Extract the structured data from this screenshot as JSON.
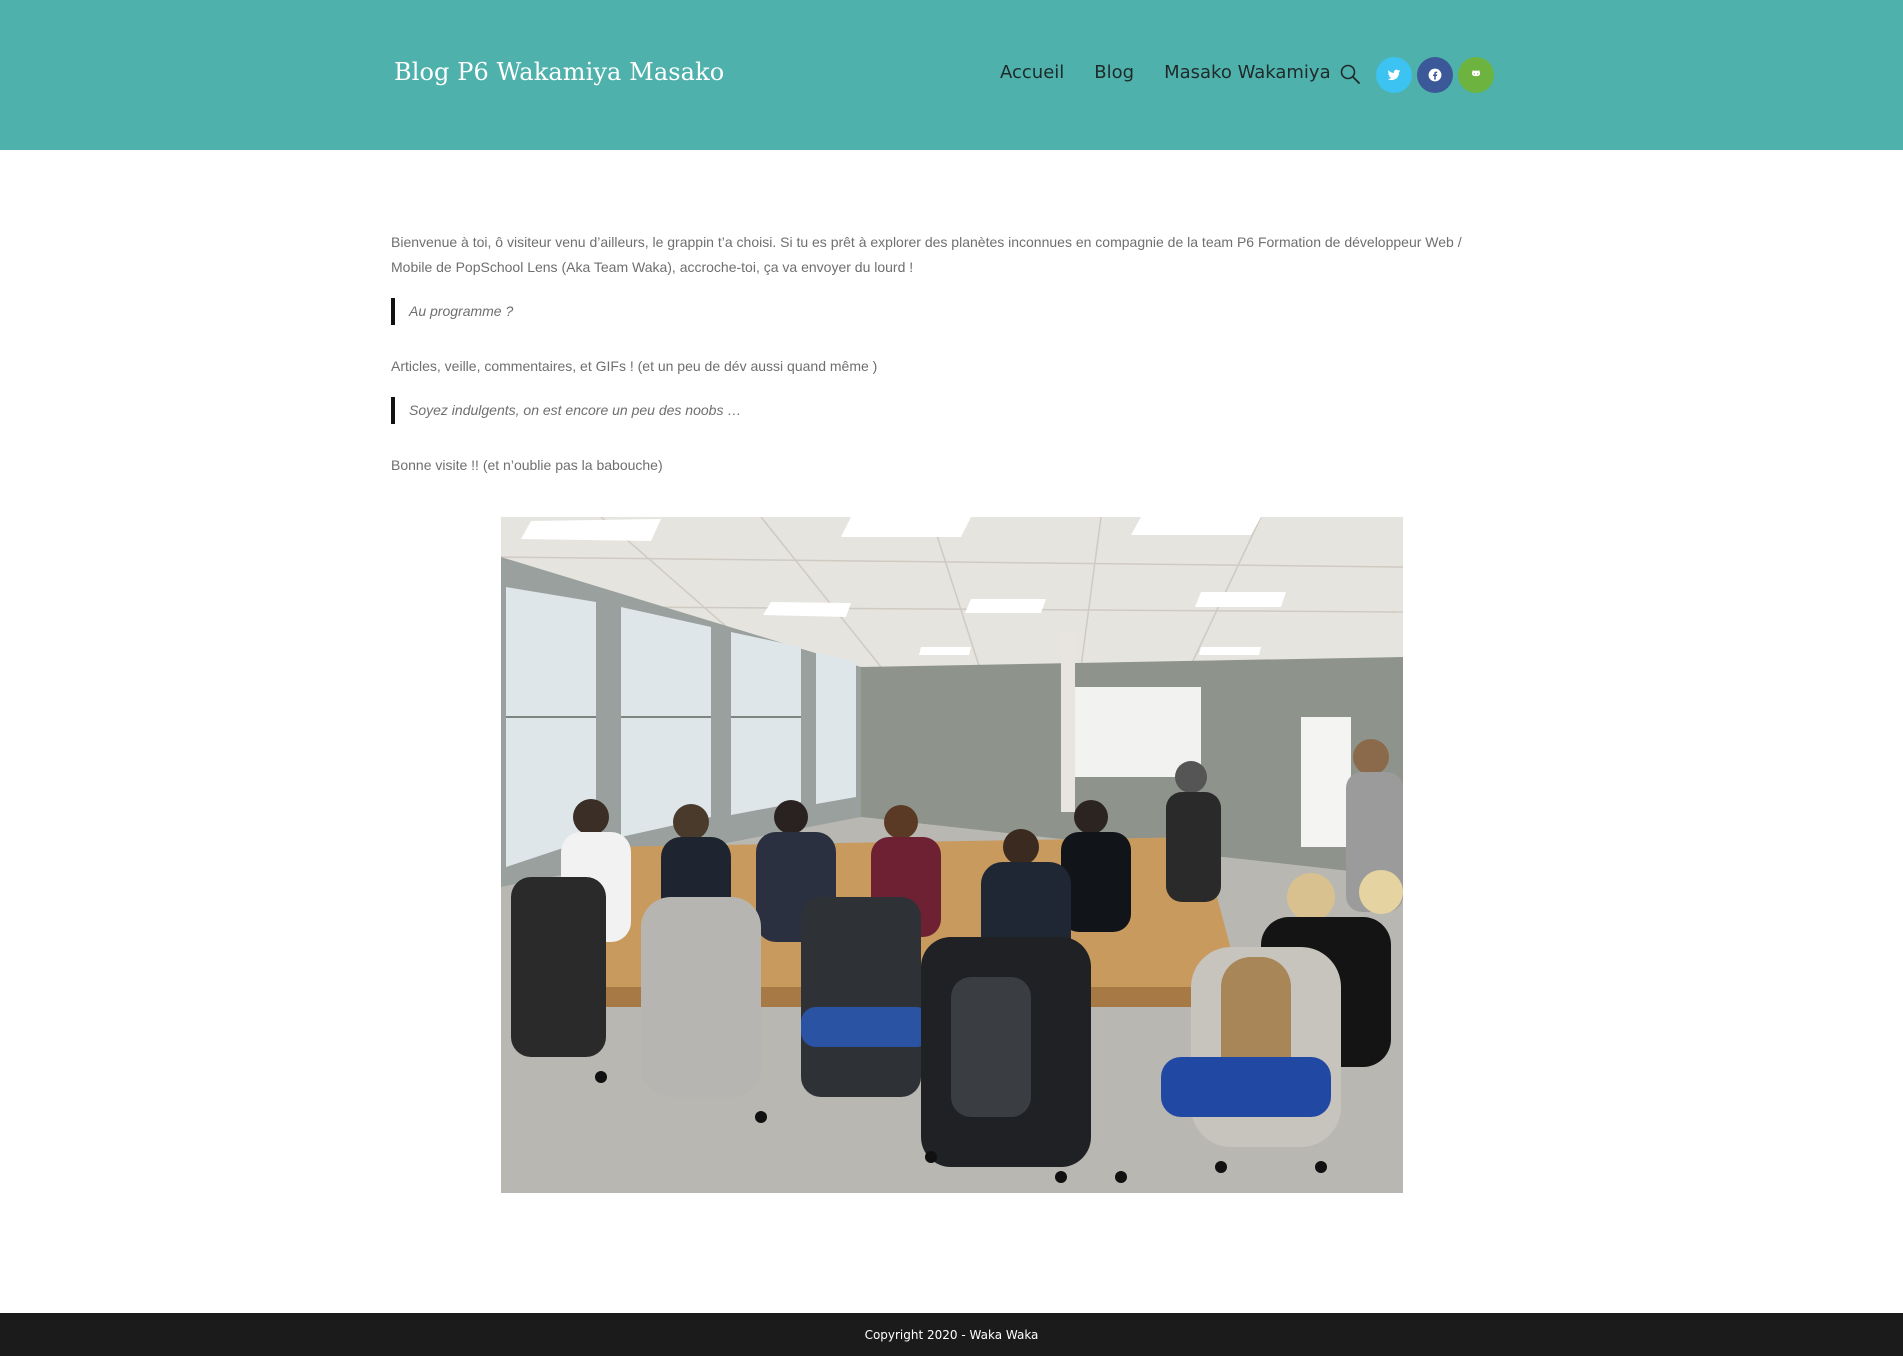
{
  "header": {
    "site_title": "Blog P6 Wakamiya Masako",
    "nav": [
      {
        "label": "Accueil"
      },
      {
        "label": "Blog"
      },
      {
        "label": "Masako Wakamiya"
      }
    ],
    "search_icon": "search-icon",
    "social": [
      {
        "name": "twitter",
        "icon": "twitter-icon",
        "color": "#3cc3f1"
      },
      {
        "name": "facebook",
        "icon": "facebook-icon",
        "color": "#3b5998"
      },
      {
        "name": "github",
        "icon": "github-icon",
        "color": "#6cb33f"
      }
    ],
    "background_color": "#4fb1ac"
  },
  "content": {
    "intro": "Bienvenue à toi, ô visiteur venu d’ailleurs, le grappin t’a choisi. Si tu es prêt à explorer des planètes inconnues en compagnie de la team P6 Formation de développeur Web / Mobile de PopSchool Lens (Aka Team Waka), accroche-toi, ça va envoyer du lourd !",
    "quote1": "Au programme ?",
    "line2": "Articles, veille,  commentaires, et GIFs ! (et un peu de dév aussi quand même )",
    "quote2": "Soyez indulgents, on est encore un peu des noobs …",
    "line3": "Bonne visite !! (et n’oublie pas la babouche)"
  },
  "footer": {
    "copyright": "Copyright 2020 - Waka Waka",
    "background_color": "#1b1b1b"
  }
}
